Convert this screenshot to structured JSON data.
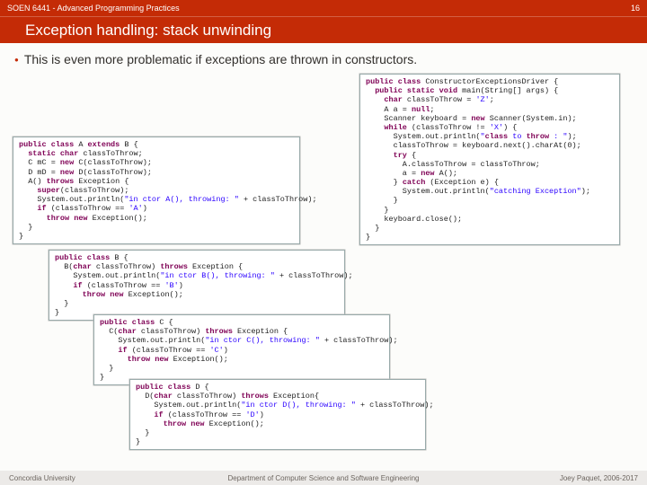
{
  "header": {
    "course": "SOEN 6441 - Advanced Programming Practices",
    "page": "16",
    "title": "Exception handling: stack unwinding"
  },
  "bullet": "This is even more problematic if exceptions are thrown in constructors.",
  "code": {
    "classA": "public class A extends B {\n  static char classToThrow;\n  C mC = new C(classToThrow);\n  D mD = new D(classToThrow);\n  A() throws Exception {\n    super(classToThrow);\n    System.out.println(\"in ctor A(), throwing: \" + classToThrow);\n    if (classToThrow == 'A')\n      throw new Exception();\n  }\n}",
    "classB": "public class B {\n  B(char classToThrow) throws Exception {\n    System.out.println(\"in ctor B(), throwing: \" + classToThrow);\n    if (classToThrow == 'B')\n      throw new Exception();\n  }\n}",
    "classC": "public class C {\n  C(char classToThrow) throws Exception {\n    System.out.println(\"in ctor C(), throwing: \" + classToThrow);\n    if (classToThrow == 'C')\n      throw new Exception();\n  }\n}",
    "classD": "public class D {\n  D(char classToThrow) throws Exception{\n    System.out.println(\"in ctor D(), throwing: \" + classToThrow);\n    if (classToThrow == 'D')\n      throw new Exception();\n  }\n}",
    "driver": "public class ConstructorExceptionsDriver {\n  public static void main(String[] args) {\n    char classToThrow = 'Z';\n    A a = null;\n    Scanner keyboard = new Scanner(System.in);\n    while (classToThrow != 'X') {\n      System.out.println(\"class to throw : \");\n      classToThrow = keyboard.next().charAt(0);\n      try {\n        A.classToThrow = classToThrow;\n        a = new A();\n      } catch (Exception e) {\n        System.out.println(\"catching Exception\");\n      }\n    }\n    keyboard.close();\n  }\n}"
  },
  "footer": {
    "left": "Concordia University",
    "center": "Department of Computer Science and Software Engineering",
    "right": "Joey Paquet, 2006-2017"
  }
}
